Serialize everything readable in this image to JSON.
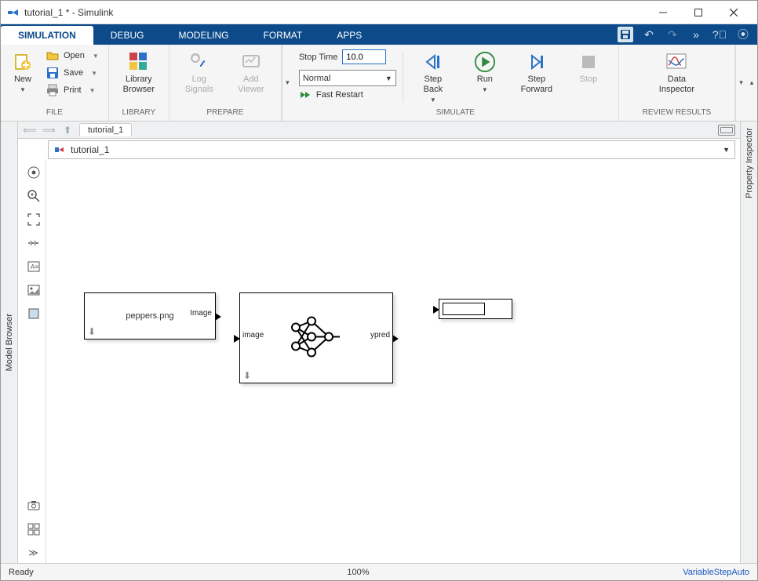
{
  "window": {
    "title": "tutorial_1 * - Simulink"
  },
  "tabs": {
    "items": [
      {
        "label": "SIMULATION",
        "active": true
      },
      {
        "label": "DEBUG"
      },
      {
        "label": "MODELING"
      },
      {
        "label": "FORMAT"
      },
      {
        "label": "APPS"
      }
    ]
  },
  "ribbon": {
    "file": {
      "group_label": "FILE",
      "new": "New",
      "open": "Open",
      "save": "Save",
      "print": "Print"
    },
    "library": {
      "group_label": "LIBRARY",
      "label": "Library\nBrowser"
    },
    "prepare": {
      "group_label": "PREPARE",
      "log_signals": "Log\nSignals",
      "add_viewer": "Add\nViewer"
    },
    "simulate": {
      "group_label": "SIMULATE",
      "stop_time_label": "Stop Time",
      "stop_time_value": "10.0",
      "mode": "Normal",
      "fast_restart": "Fast Restart",
      "step_back": "Step\nBack",
      "run": "Run",
      "step_forward": "Step\nForward",
      "stop": "Stop"
    },
    "review": {
      "group_label": "REVIEW RESULTS",
      "data_inspector": "Data\nInspector"
    }
  },
  "side_panels": {
    "left": "Model Browser",
    "right": "Property Inspector"
  },
  "nav": {
    "model_tab": "tutorial_1",
    "breadcrumb": "tutorial_1"
  },
  "blocks": {
    "image_from_file": {
      "text": "peppers.png",
      "out_port": "Image"
    },
    "predict": {
      "in_port": "image",
      "out_port": "ypred"
    }
  },
  "status": {
    "ready": "Ready",
    "zoom": "100%",
    "solver": "VariableStepAuto"
  }
}
